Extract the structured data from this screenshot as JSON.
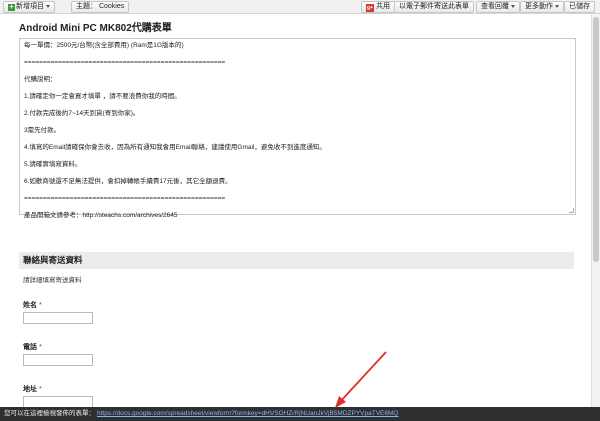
{
  "toolbar": {
    "new_item": "新增項目",
    "theme": "主題： Cookies",
    "share": "共用",
    "email_form": "以電子郵件寄送此表單",
    "view_responses": "查看回覆",
    "more_actions": "更多動作",
    "saved": "已儲存"
  },
  "form": {
    "title": "Android Mini PC MK802代購表單",
    "description_lines": [
      "每一單價：2500元/台幣(含全部費用) (Ram是1G版本的)",
      "",
      "=====================================================",
      "",
      "代購說明：",
      "",
      "1.請確定你一定會買才填單 ，請不要浪費你我的時間。",
      "",
      "2.付款完成後約7~14天到貨(寄到你家)。",
      "",
      "3需先付款。",
      "",
      "4.填寫的Email請確保你會去收，因為所有通知我會用Email聯絡，建議使用Gmail，避免收不到進度通知。",
      "",
      "5.請確實填寫資料。",
      "",
      "6.如歡商號還不足無法提供，會扣掉轉帳手續費17元後，其它全額退費。",
      "",
      "=====================================================",
      "",
      "產品開箱文請參考：http://steachs.com/archives/2645"
    ]
  },
  "section": {
    "title": "聯絡與寄送資料",
    "description": "請詳細填寫寄送資料"
  },
  "questions": [
    {
      "label": "姓名",
      "required": "*"
    },
    {
      "label": "電話",
      "required": "*"
    },
    {
      "label": "地址",
      "required": "*"
    }
  ],
  "bottom": {
    "text": "您可以在這裡檢視發佈的表單：",
    "link": "https://docs.google.com/spreadsheet/viewform?formkey=dHVSOHZrRjNUanJkVjB5MDZPYVpaTVE6MQ"
  },
  "colors": {
    "annotation_arrow": "#d9302a",
    "required_star": "#cc1111",
    "link": "#8ab4f8"
  }
}
